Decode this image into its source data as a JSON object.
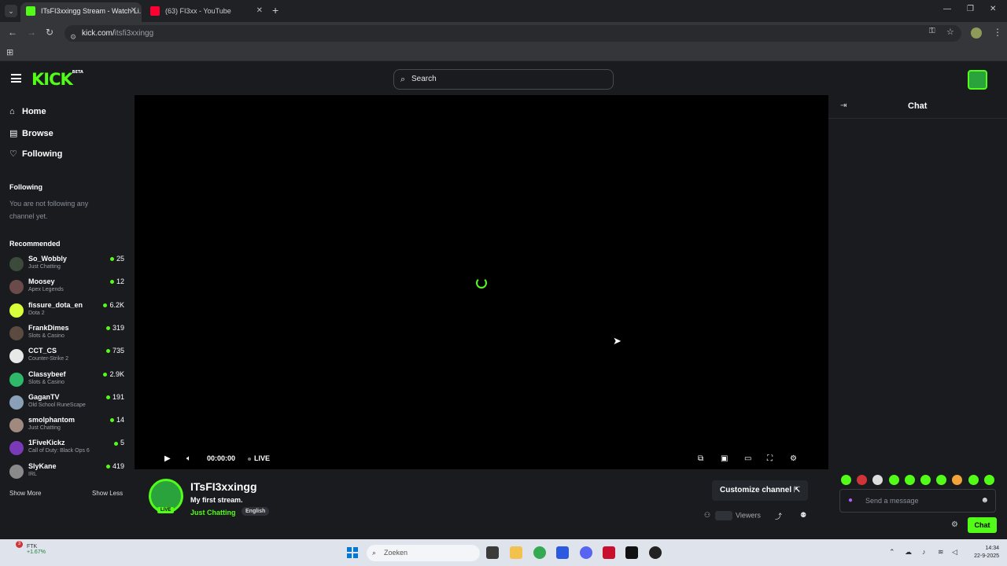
{
  "browser": {
    "tabs": [
      {
        "label": "ITsFI3xxingg Stream - Watch Li...",
        "active": true
      },
      {
        "label": "(63) FI3xx - YouTube",
        "active": false
      }
    ],
    "new_tab": "+",
    "url_host": "kick.com/",
    "url_path": "itsfi3xxingg"
  },
  "header": {
    "logo": "KICK",
    "logo_badge": "BETA",
    "search_placeholder": "Search"
  },
  "sidebar": {
    "nav": [
      {
        "label": "Home",
        "icon": "home-icon"
      },
      {
        "label": "Browse",
        "icon": "browse-icon"
      },
      {
        "label": "Following",
        "icon": "heart-icon"
      }
    ],
    "following_heading": "Following",
    "following_note": "You are not following any channel yet.",
    "recommended_heading": "Recommended",
    "recommended": [
      {
        "name": "So_Wobbly",
        "category": "Just Chatting",
        "viewers": "25",
        "color": "#3b4a3a"
      },
      {
        "name": "Moosey",
        "category": "Apex Legends",
        "viewers": "12",
        "color": "#6b4a4a"
      },
      {
        "name": "fissure_dota_en",
        "category": "Dota 2",
        "viewers": "6.2K",
        "color": "#d8ff3a"
      },
      {
        "name": "FrankDimes",
        "category": "Slots & Casino",
        "viewers": "319",
        "color": "#5a4a40"
      },
      {
        "name": "CCT_CS",
        "category": "Counter-Strike 2",
        "viewers": "735",
        "color": "#e8e8e8"
      },
      {
        "name": "Classybeef",
        "category": "Slots & Casino",
        "viewers": "2.9K",
        "color": "#2eb86a"
      },
      {
        "name": "GaganTV",
        "category": "Old School RuneScape",
        "viewers": "191",
        "color": "#8aa0b8"
      },
      {
        "name": "smolphantom",
        "category": "Just Chatting",
        "viewers": "14",
        "color": "#a08a80"
      },
      {
        "name": "1FiveKickz",
        "category": "Call of Duty: Black Ops 6",
        "viewers": "5",
        "color": "#7a3ab8"
      },
      {
        "name": "SlyKane",
        "category": "IRL",
        "viewers": "419",
        "color": "#8a8a8a"
      }
    ],
    "show_more": "Show More",
    "show_less": "Show Less"
  },
  "player": {
    "time": "00:00:00",
    "live": "LIVE"
  },
  "channel": {
    "name": "ITsFI3xxingg",
    "title": "My first stream.",
    "category": "Just Chatting",
    "language": "English",
    "live_tag": "LIVE",
    "customize": "Customize channel",
    "viewers_label": "Viewers"
  },
  "chat": {
    "title": "Chat",
    "placeholder": "Send a message",
    "send": "Chat"
  },
  "taskbar": {
    "stock_name": "FTK",
    "stock_change": "+1.67%",
    "stock_badge": "3",
    "search_placeholder": "Zoeken",
    "time": "14:34",
    "date": "22-9-2025"
  },
  "colors": {
    "kick_green": "#53fc18",
    "background": "#191b1f",
    "player": "#000000"
  }
}
